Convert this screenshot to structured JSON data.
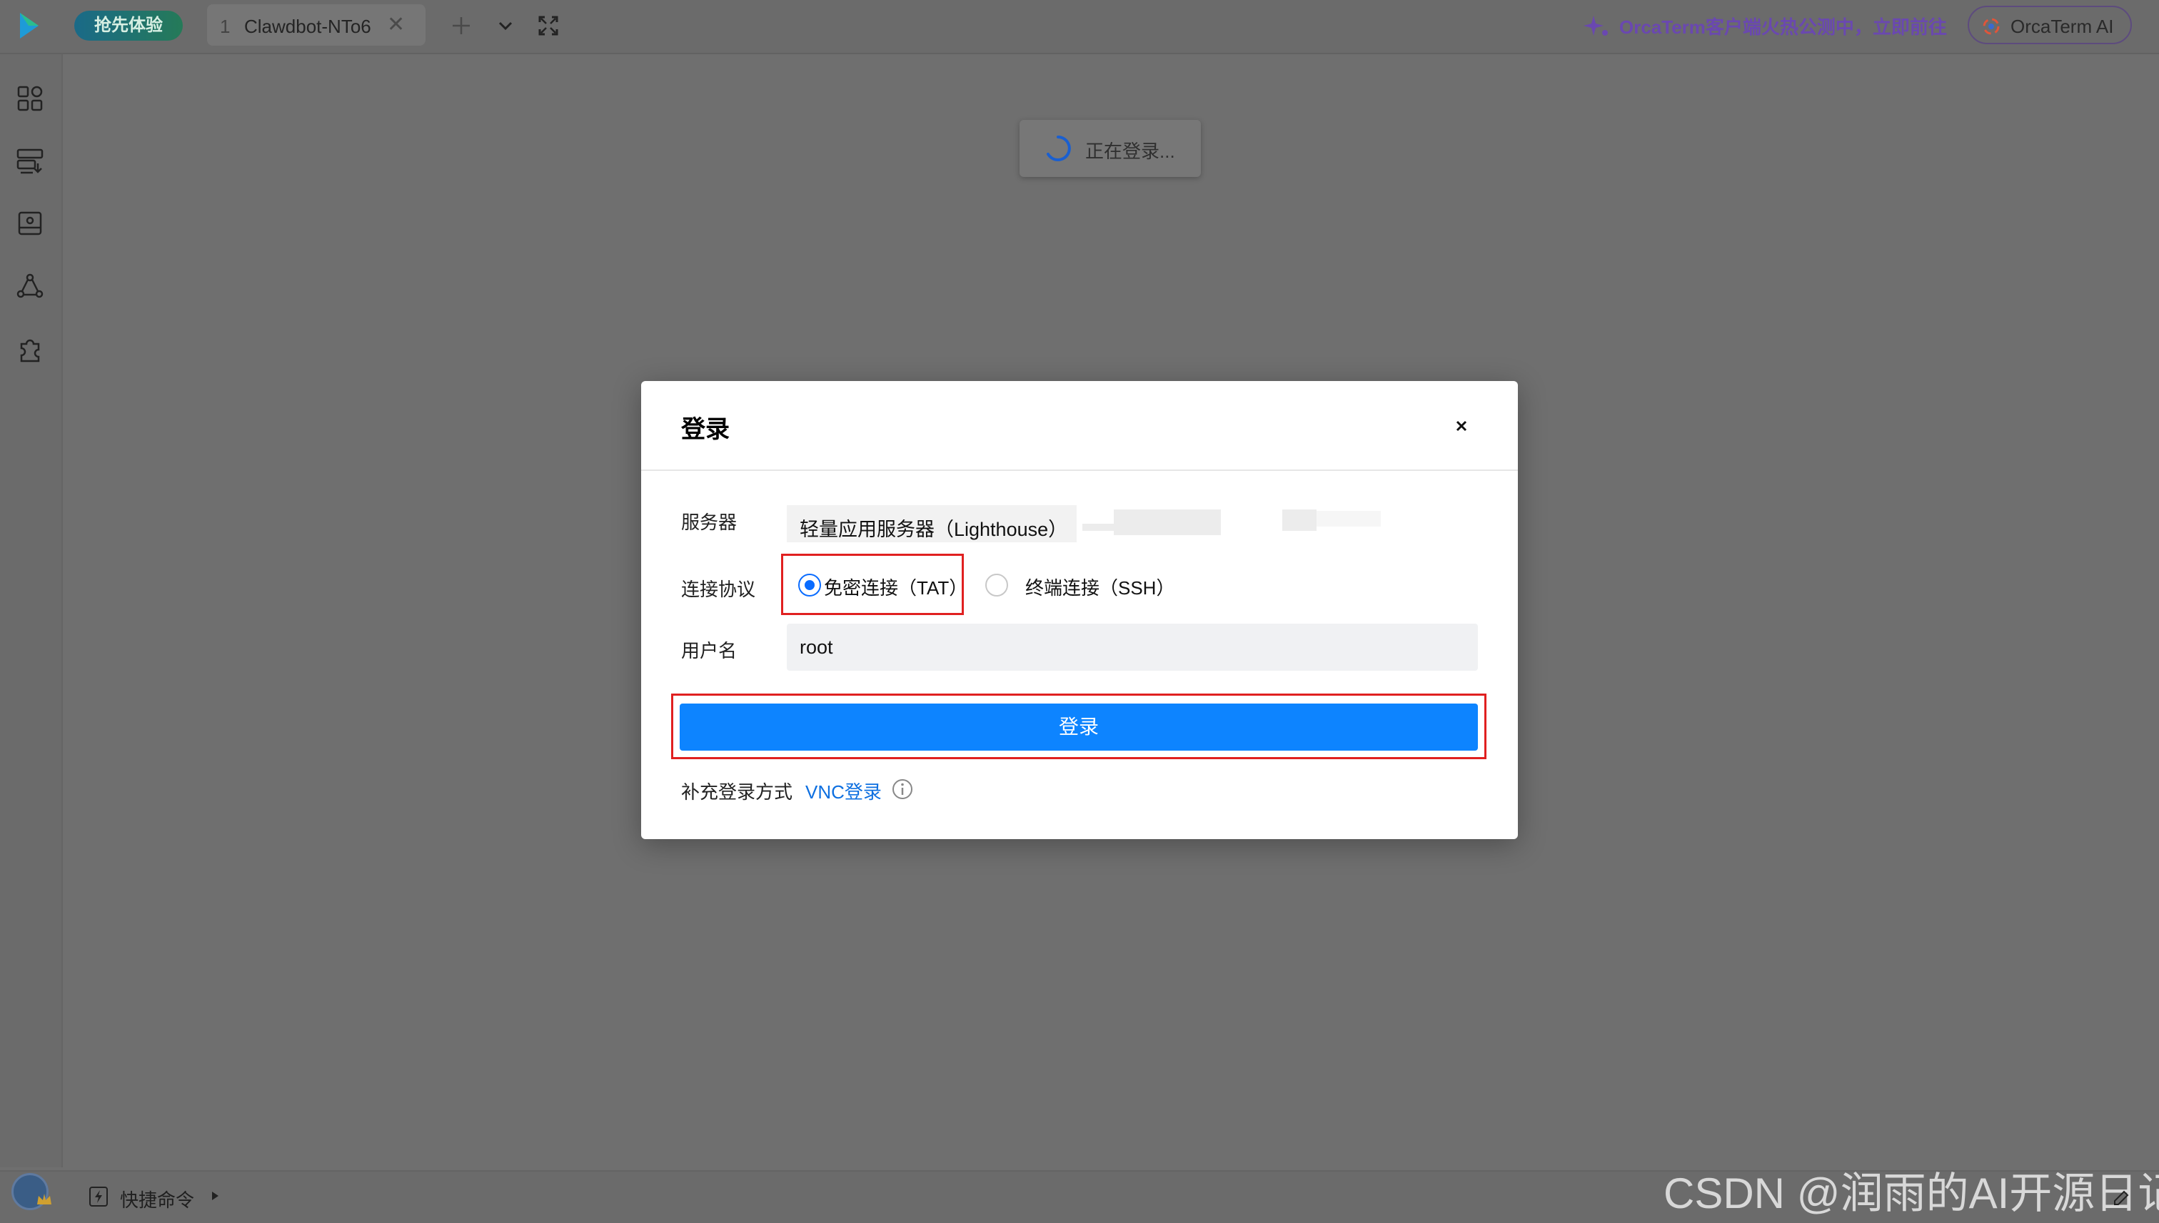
{
  "topbar": {
    "promo_pill": "抢先体验",
    "tab": {
      "number": "1",
      "title": "Clawdbot-NTo6",
      "close": "✕"
    },
    "promo_text": "OrcaTerm客户端火热公测中，立即前往",
    "ai_button": "OrcaTerm AI"
  },
  "toast": {
    "text": "正在登录..."
  },
  "dialog": {
    "title": "登录",
    "server_label": "服务器",
    "server_value": "轻量应用服务器（Lighthouse）",
    "protocol_label": "连接协议",
    "protocol_options": [
      "免密连接（TAT）",
      "终端连接（SSH）"
    ],
    "protocol_selected": "免密连接（TAT）",
    "username_label": "用户名",
    "username_value": "root",
    "login_button": "登录",
    "extra_label": "补充登录方式",
    "vnc_link": "VNC登录"
  },
  "bottombar": {
    "quick_commands": "快捷命令"
  },
  "watermark": "CSDN @润雨的AI开源日记",
  "colors": {
    "primary": "#0d84ff",
    "highlight": "#e02020",
    "link": "#0d6fe0",
    "radio": "#0a6cff"
  },
  "icons": [
    "app-logo-icon",
    "add-tab-icon",
    "tab-dropdown-icon",
    "fullscreen-icon",
    "sparkle-icon",
    "ai-logo-icon",
    "apps-grid-icon",
    "server-list-icon",
    "instance-icon",
    "network-icon",
    "plugin-icon",
    "spinner-icon",
    "close-icon",
    "info-icon",
    "bolt-icon",
    "expand-arrow-icon"
  ]
}
